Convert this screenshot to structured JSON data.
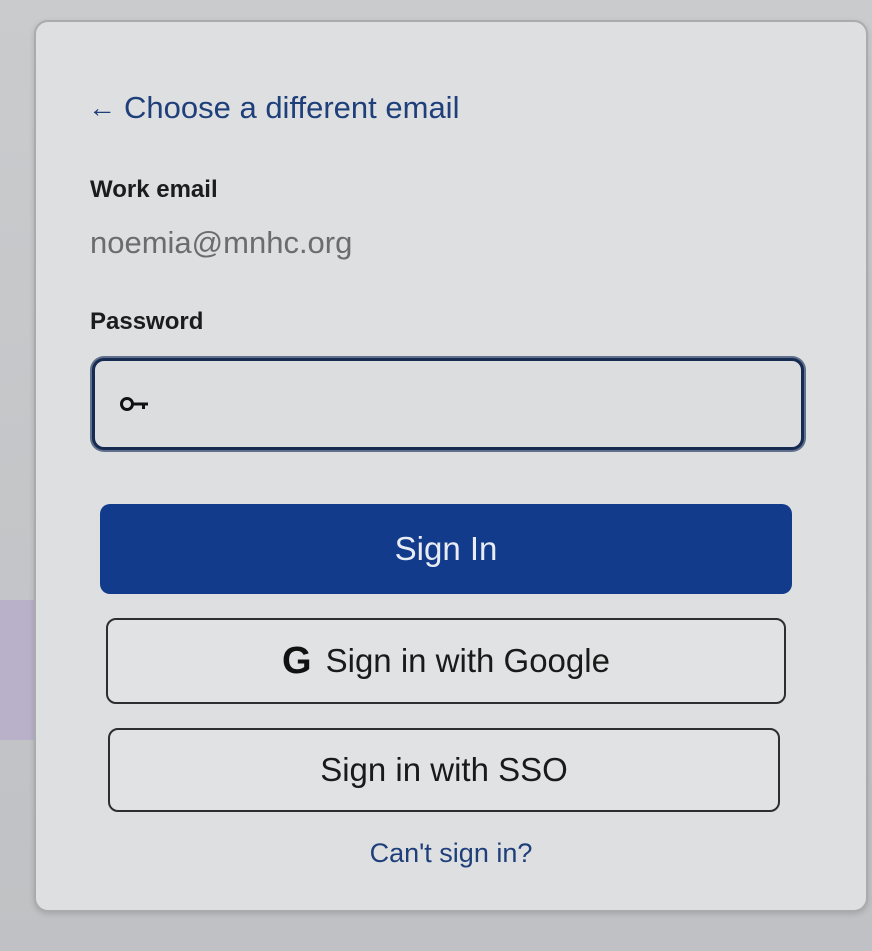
{
  "signin": {
    "back_link_arrow": "←",
    "back_link_label": "Choose a different email",
    "email_label": "Work email",
    "email_value": "noemia@mnhc.org",
    "password_label": "Password",
    "password_value": "",
    "sign_in_label": "Sign In",
    "google_g": "G",
    "google_label": "Sign in with Google",
    "sso_label": "Sign in with SSO",
    "cant_sign_in_label": "Can't sign in?"
  },
  "icons": {
    "key": "key-icon",
    "arrow": "arrow-left-icon",
    "google": "google-icon"
  },
  "colors": {
    "primary": "#123b8c",
    "link": "#1e3f7a",
    "field_border": "#152b4f"
  }
}
